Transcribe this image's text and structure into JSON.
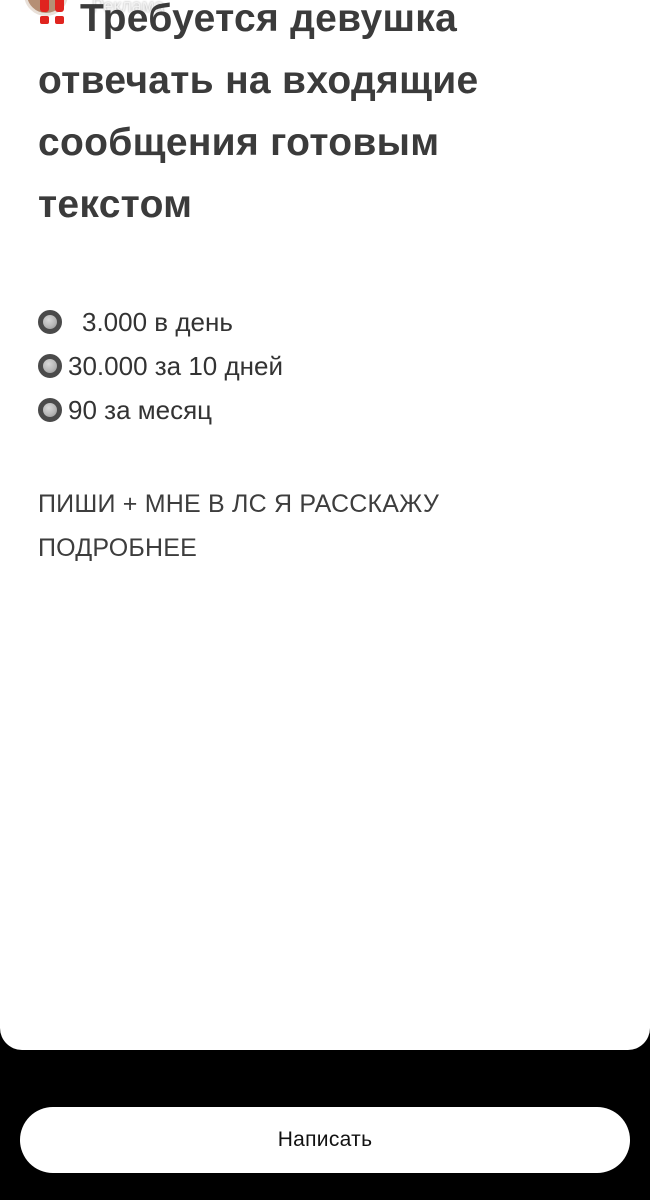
{
  "header": {
    "avatar_icon": "profile-avatar",
    "sponsored_label": "Реклама"
  },
  "story": {
    "headline_icon": "double-exclamation-icon",
    "headline_lines": [
      "Требуется девушка",
      "отвечать на входящие",
      "сообщения готовым",
      "текстом"
    ],
    "bullets": [
      {
        "icon": "radio-button-icon",
        "text": "3.000 в день"
      },
      {
        "icon": "radio-button-icon",
        "text": "30.000 за 10 дней"
      },
      {
        "icon": "radio-button-icon",
        "text": "90 за месяц"
      }
    ],
    "cta_lines": [
      "ПИШИ + МНЕ В ЛС Я РАССКАЖУ",
      "ПОДРОБНЕЕ"
    ],
    "colors": {
      "headline": "#3b3b3b",
      "warning": "#e0241f",
      "background": "#ffffff"
    }
  },
  "footer": {
    "reply_button_label": "Написать",
    "background": "#000000"
  }
}
